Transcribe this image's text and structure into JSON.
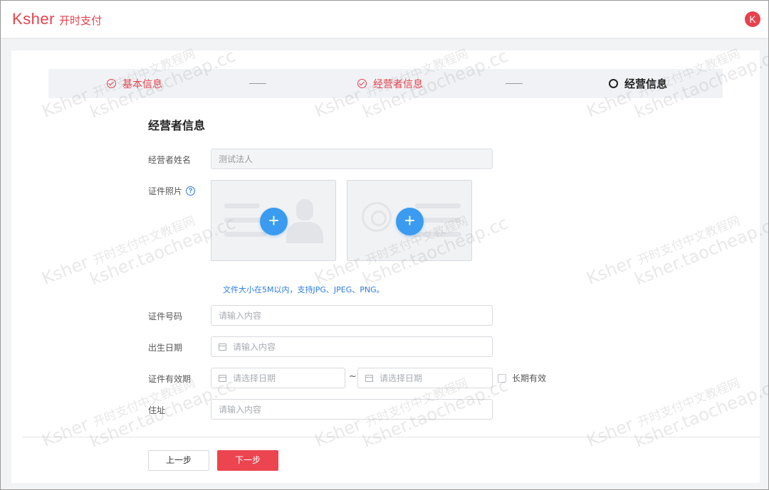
{
  "brand": {
    "logo_word": "Ksher",
    "logo_cn": "开时支付",
    "avatar_letter": "K",
    "accent_color": "#e8404c"
  },
  "steps": [
    {
      "label": "基本信息",
      "state": "done"
    },
    {
      "label": "经营者信息",
      "state": "done"
    },
    {
      "label": "经营信息",
      "state": "current"
    }
  ],
  "form": {
    "title": "经营者信息",
    "name": {
      "label": "经营者姓名",
      "value": "测试法人"
    },
    "photo": {
      "label": "证件照片",
      "help_icon": "question-circle-icon",
      "hint": "文件大小在5M以内，支持JPG、JPEG、PNG。"
    },
    "id_number": {
      "label": "证件号码",
      "placeholder": "请输入内容"
    },
    "birth_date": {
      "label": "出生日期",
      "placeholder": "请输入内容"
    },
    "validity": {
      "label": "证件有效期",
      "start_placeholder": "请选择日期",
      "separator": "~",
      "end_placeholder": "请选择日期",
      "long_term_label": "长期有效"
    },
    "address": {
      "label": "住址",
      "placeholder": "请输入内容"
    }
  },
  "actions": {
    "prev_label": "上一步",
    "next_label": "下一步"
  },
  "watermark": {
    "line1_word": "Ksher",
    "line1_cn": "开时支付中文教程网",
    "line2": "ksher.taocheap.cc"
  }
}
